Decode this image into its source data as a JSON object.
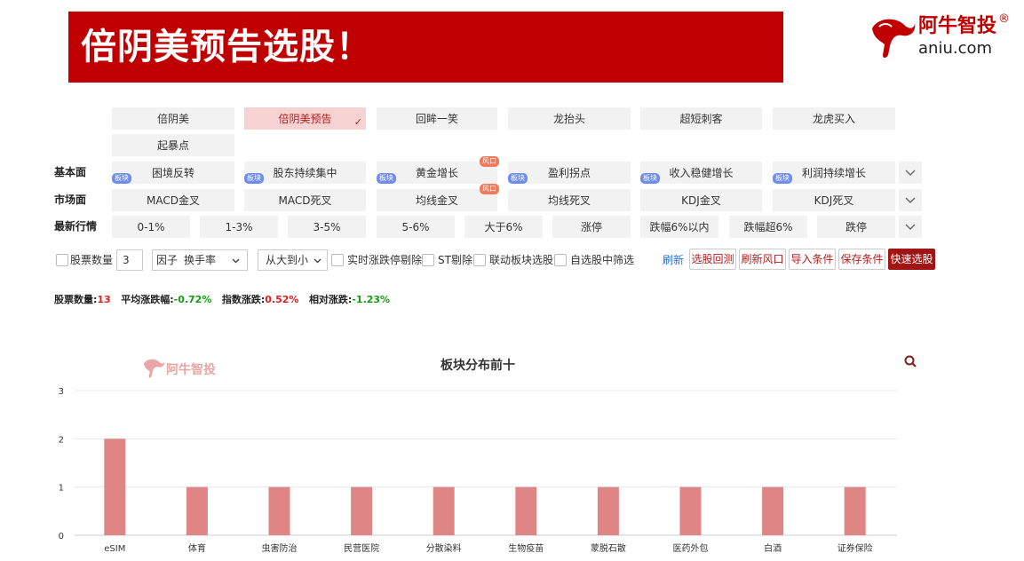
{
  "banner": {
    "title": "倍阴美预告选股！"
  },
  "logo": {
    "name": "阿牛智投",
    "reg": "®",
    "url": "aniu.com"
  },
  "strategies": [
    {
      "label": "倍阴美",
      "selected": false
    },
    {
      "label": "倍阴美预告",
      "selected": true
    },
    {
      "label": "回眸一笑",
      "selected": false
    },
    {
      "label": "龙抬头",
      "selected": false
    },
    {
      "label": "超短刺客",
      "selected": false
    },
    {
      "label": "龙虎买入",
      "selected": false
    },
    {
      "label": "起暴点",
      "selected": false
    }
  ],
  "rows": {
    "fundamental": {
      "label": "基本面",
      "items": [
        {
          "label": "困境反转",
          "tag": "板块"
        },
        {
          "label": "股东持续集中",
          "tag": "板块"
        },
        {
          "label": "黄金增长",
          "tag": "板块",
          "badge": "风口"
        },
        {
          "label": "盈利拐点",
          "tag": "板块"
        },
        {
          "label": "收入稳健增长",
          "tag": "板块"
        },
        {
          "label": "利润持续增长",
          "tag": "板块"
        }
      ]
    },
    "market": {
      "label": "市场面",
      "items": [
        {
          "label": "MACD金叉"
        },
        {
          "label": "MACD死叉"
        },
        {
          "label": "均线金叉",
          "badge": "风口"
        },
        {
          "label": "均线死叉"
        },
        {
          "label": "KDJ金叉"
        },
        {
          "label": "KDJ死叉"
        }
      ]
    },
    "quote": {
      "label": "最新行情",
      "items": [
        {
          "label": "0-1%"
        },
        {
          "label": "1-3%"
        },
        {
          "label": "3-5%"
        },
        {
          "label": "5-6%"
        },
        {
          "label": "大于6%"
        },
        {
          "label": "涨停"
        },
        {
          "label": "跌幅6%以内"
        },
        {
          "label": "跌幅超6%"
        },
        {
          "label": "跌停"
        }
      ]
    }
  },
  "controls": {
    "stock_count_label": "股票数量",
    "stock_count_value": "3",
    "factor_label": "因子",
    "factor_value": "换手率",
    "order_value": "从大到小",
    "realtime_remove": "实时涨跌停剔除",
    "st_remove": "ST剔除",
    "linked_sector": "联动板块选股",
    "own_filter": "自选股中筛选",
    "refresh": "刷新",
    "buttons": [
      "选股回测",
      "刷新风口",
      "导入条件",
      "保存条件"
    ],
    "primary_button": "快速选股"
  },
  "stats": {
    "count_label": "股票数量:",
    "count_value": "13",
    "avg_label": "平均涨跌幅:",
    "avg_value": "-0.72%",
    "index_label": "指数涨跌:",
    "index_value": "0.52%",
    "rel_label": "相对涨跌:",
    "rel_value": "-1.23%"
  },
  "colors": {
    "brand_red": "#c00000",
    "bar": "#e08585",
    "rise": "#e02020",
    "fall": "#11a011"
  },
  "chart_data": {
    "type": "bar",
    "title": "板块分布前十",
    "watermark": "阿牛智投",
    "categories": [
      "eSIM",
      "体育",
      "虫害防治",
      "民营医院",
      "分散染料",
      "生物疫苗",
      "蒙脱石散",
      "医药外包",
      "白酒",
      "证券保险"
    ],
    "values": [
      2,
      1,
      1,
      1,
      1,
      1,
      1,
      1,
      1,
      1
    ],
    "ylim": [
      0,
      3
    ],
    "yticks": [
      0,
      1,
      2,
      3
    ],
    "grid": true,
    "xlabel": "",
    "ylabel": ""
  }
}
